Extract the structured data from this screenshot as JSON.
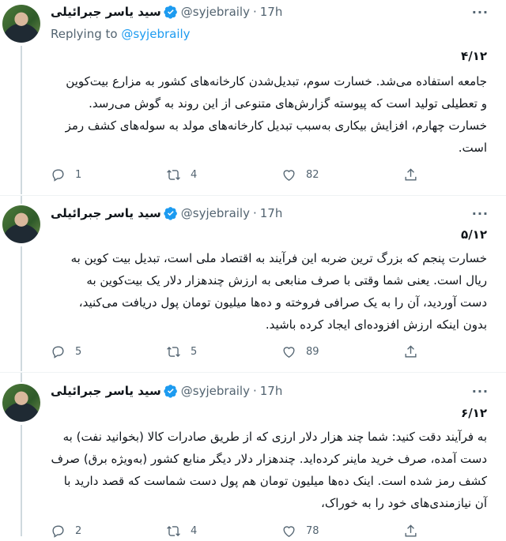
{
  "tweets": [
    {
      "display_name": "سید یاسر جبرائیلی",
      "handle": "@syjebraily",
      "dot": "·",
      "time": "17h",
      "more": "···",
      "replying_prefix": "Replying to",
      "replying_handle": "@syjebraily",
      "counter": "۴/۱۲",
      "text": "جامعه استفاده می‌شد. خسارت سوم، تبدیل‌شدن کارخانه‌های کشور به مزارع بیت‌کوین\nو تعطیلی تولید است که پیوسته گزارش‌های متنوعی از این روند به گوش می‌رسد.\nخسارت چهارم، افزایش بیکاری به‌سبب تبدیل کارخانه‌های مولد به سوله‌های کشف رمز\nاست.",
      "replies": "1",
      "retweets": "4",
      "likes": "82"
    },
    {
      "display_name": "سید یاسر جبرائیلی",
      "handle": "@syjebraily",
      "dot": "·",
      "time": "17h",
      "more": "···",
      "counter": "۵/۱۲",
      "text": "خسارت پنجم که بزرگ ترین ضربه این فرآیند به اقتصاد ملی است، تبدیل بیت کوین به\nریال است. یعنی شما وقتی با صرف منابعی به ارزش چندهزار دلار یک بیت‌کوین به\nدست آوردید، آن را به یک صرافی فروخته و ده‌ها میلیون تومان پول دریافت می‌کنید،\nبدون اینکه ارزش افزوده‌ای ایجاد کرده باشید.",
      "replies": "5",
      "retweets": "5",
      "likes": "89"
    },
    {
      "display_name": "سید یاسر جبرائیلی",
      "handle": "@syjebraily",
      "dot": "·",
      "time": "17h",
      "more": "···",
      "counter": "۶/۱۲",
      "text": "به فرآیند دقت کنید: شما چند هزار دلار ارزی که از طریق صادرات کالا (بخوانید نفت) به\nدست آمده، صرف خرید ماینر کرده‌اید. چندهزار دلار دیگر منابع کشور (به‌ویژه برق) صرف\nکشف رمز شده است. اینک ده‌ها میلیون تومان هم پول دست شماست که قصد دارید با\nآن نیازمندی‌های خود را به خوراک،",
      "replies": "2",
      "retweets": "4",
      "likes": "78"
    }
  ],
  "icons": {
    "reply": "reply-icon",
    "retweet": "retweet-icon",
    "like": "heart-icon",
    "share": "share-icon",
    "verified": "verified-badge-icon"
  },
  "colors": {
    "accent": "#1d9bf0",
    "secondary_text": "#536471",
    "divider": "#eff3f4"
  }
}
